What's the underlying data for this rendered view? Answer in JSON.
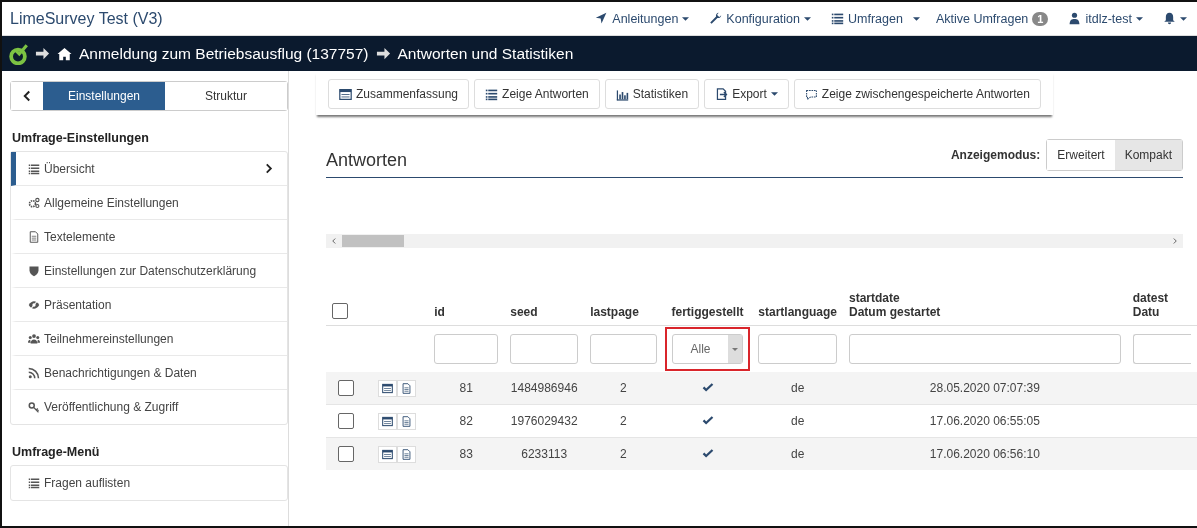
{
  "app_bar": {
    "title": "LimeSurvey Test (V3)",
    "menus": [
      {
        "label": "Anleitungen",
        "dropdown": true
      },
      {
        "label": "Konfiguration",
        "dropdown": true
      },
      {
        "label": "Umfragen",
        "dropdown": false,
        "split_caret": true
      },
      {
        "label": "Aktive Umfragen",
        "dropdown": false,
        "badge": "1"
      },
      {
        "label": "itdlz-test",
        "dropdown": true
      },
      {
        "dropdown": true
      }
    ]
  },
  "breadcrumb": [
    "Anmeldung zum Betriebsausflug (137757)",
    "Antworten und Statistiken"
  ],
  "sidebar": {
    "tabs": [
      {
        "label": "Einstellungen",
        "selected": true
      },
      {
        "label": "Struktur",
        "selected": false
      }
    ],
    "sections": [
      {
        "title": "Umfrage-Einstellungen",
        "items": [
          {
            "label": "Übersicht",
            "selected": true
          },
          {
            "label": "Allgemeine Einstellungen",
            "selected": false
          },
          {
            "label": "Textelemente",
            "selected": false
          },
          {
            "label": "Einstellungen zur Datenschutzerklärung",
            "selected": false
          },
          {
            "label": "Präsentation",
            "selected": false
          },
          {
            "label": "Teilnehmereinstellungen",
            "selected": false
          },
          {
            "label": "Benachrichtigungen & Daten",
            "selected": false
          },
          {
            "label": "Veröffentlichung & Zugriff",
            "selected": false
          }
        ]
      },
      {
        "title": "Umfrage-Menü",
        "items": [
          {
            "label": "Fragen auflisten",
            "selected": false
          }
        ]
      }
    ]
  },
  "toolbar": [
    {
      "label": "Zusammenfassung",
      "dropdown": false
    },
    {
      "label": "Zeige Antworten",
      "dropdown": false
    },
    {
      "label": "Statistiken",
      "dropdown": false
    },
    {
      "label": "Export",
      "dropdown": true
    },
    {
      "label": "Zeige zwischengespeicherte Antworten",
      "dropdown": false
    }
  ],
  "panel": {
    "title": "Antworten",
    "display_mode": {
      "label": "Anzeigemodus:",
      "options": [
        {
          "label": "Erweitert",
          "selected": false
        },
        {
          "label": "Kompakt",
          "selected": true
        }
      ]
    }
  },
  "table": {
    "select_all": {
      "checked": false
    },
    "columns": [
      {
        "kind": "checkbox"
      },
      {
        "kind": "actions"
      },
      {
        "kind": "text",
        "lines": [
          "id"
        ],
        "filter": {
          "kind": "text"
        }
      },
      {
        "kind": "text",
        "lines": [
          "seed"
        ],
        "filter": {
          "kind": "text"
        }
      },
      {
        "kind": "text",
        "lines": [
          "lastpage"
        ],
        "filter": {
          "kind": "text"
        }
      },
      {
        "kind": "status",
        "lines": [
          "fertiggestellt"
        ],
        "filter": {
          "kind": "select",
          "value": "Alle",
          "highlighted": true
        }
      },
      {
        "kind": "text",
        "lines": [
          "startlanguage"
        ],
        "filter": {
          "kind": "text"
        }
      },
      {
        "kind": "text",
        "lines": [
          "startdate",
          "Datum gestartet"
        ],
        "filter": {
          "kind": "text"
        }
      },
      {
        "kind": "text",
        "lines": [
          "datest",
          "Datu"
        ],
        "filter": {
          "kind": "text"
        }
      }
    ],
    "rows": [
      {
        "checked": false,
        "complete": true,
        "cells": [
          "",
          "",
          "81",
          "1484986946",
          "2",
          "",
          "de",
          "28.05.2020 07:07:39"
        ]
      },
      {
        "checked": false,
        "complete": true,
        "cells": [
          "",
          "",
          "82",
          "1976029432",
          "2",
          "",
          "de",
          "17.06.2020 06:55:05"
        ]
      },
      {
        "checked": false,
        "complete": true,
        "cells": [
          "",
          "",
          "83",
          "6233113",
          "2",
          "",
          "de",
          "17.06.2020 06:56:10"
        ]
      }
    ]
  }
}
